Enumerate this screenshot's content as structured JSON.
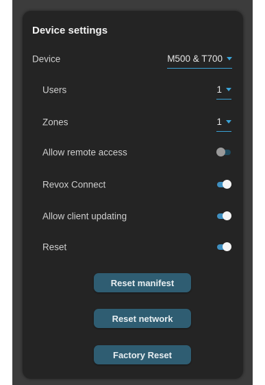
{
  "panel": {
    "title": "Device settings"
  },
  "device": {
    "label": "Device",
    "value": "M500 & T700"
  },
  "users": {
    "label": "Users",
    "value": "1"
  },
  "zones": {
    "label": "Zones",
    "value": "1"
  },
  "toggles": [
    {
      "label": "Allow remote access",
      "on": false
    },
    {
      "label": "Revox Connect",
      "on": true
    },
    {
      "label": "Allow client updating",
      "on": true
    },
    {
      "label": "Reset",
      "on": true
    }
  ],
  "buttons": {
    "reset_manifest": "Reset manifest",
    "reset_network": "Reset network",
    "factory_reset": "Factory Reset"
  },
  "colors": {
    "accent": "#3ba4d8",
    "button_bg": "#2f5d72",
    "panel_bg": "#242424"
  }
}
